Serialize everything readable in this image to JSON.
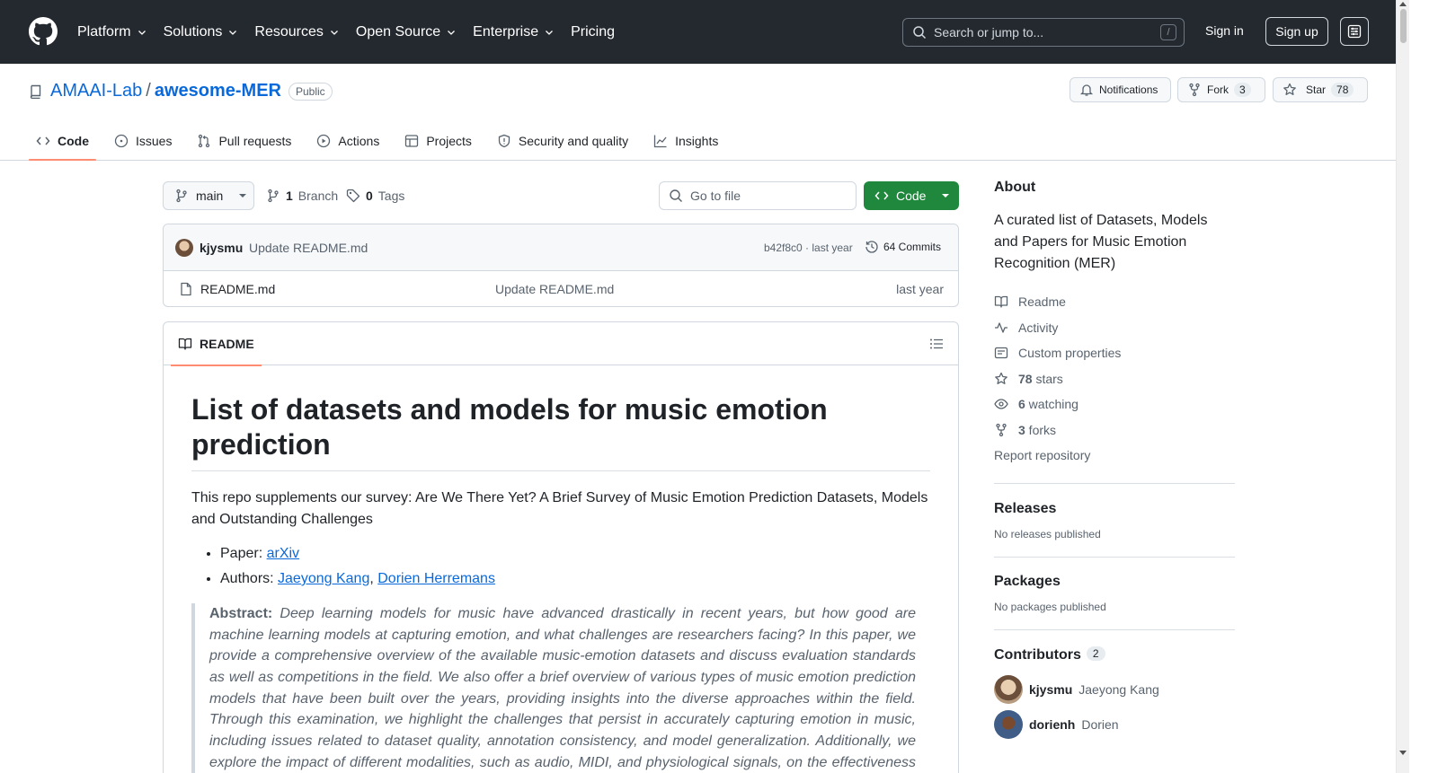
{
  "header": {
    "nav": [
      "Platform",
      "Solutions",
      "Resources",
      "Open Source",
      "Enterprise",
      "Pricing"
    ],
    "search_placeholder": "Search or jump to...",
    "search_shortcut": "/",
    "sign_in": "Sign in",
    "sign_up": "Sign up"
  },
  "repo": {
    "owner": "AMAAI-Lab",
    "separator": "/",
    "name": "awesome-MER",
    "visibility": "Public",
    "notifications_label": "Notifications",
    "fork_label": "Fork",
    "fork_count": "3",
    "star_label": "Star",
    "star_count": "78"
  },
  "tabs": [
    {
      "label": "Code",
      "icon": "code-icon",
      "active": true
    },
    {
      "label": "Issues",
      "icon": "issue-icon"
    },
    {
      "label": "Pull requests",
      "icon": "pull-request-icon"
    },
    {
      "label": "Actions",
      "icon": "play-icon"
    },
    {
      "label": "Projects",
      "icon": "table-icon"
    },
    {
      "label": "Security and quality",
      "icon": "shield-icon"
    },
    {
      "label": "Insights",
      "icon": "graph-icon"
    }
  ],
  "toolbar": {
    "branch": "main",
    "branch_count": "1",
    "branch_label": "Branch",
    "tag_count": "0",
    "tag_label": "Tags",
    "goto_placeholder": "Go to file",
    "code_button": "Code"
  },
  "commit": {
    "user": "kjysmu",
    "message": "Update README.md",
    "hash_time": "b42f8c0 · last year",
    "commits_label": "64 Commits"
  },
  "files": [
    {
      "name": "README.md",
      "message": "Update README.md",
      "time": "last year"
    }
  ],
  "readme": {
    "tab_label": "README",
    "title": "List of datasets and models for music emotion prediction",
    "lead": "This repo supplements our survey: Are We There Yet? A Brief Survey of Music Emotion Prediction Datasets, Models and Outstanding Challenges",
    "paper_label": "Paper: ",
    "paper_link": "arXiv",
    "authors_label": "Authors: ",
    "author1": "Jaeyong Kang",
    "author_sep": ", ",
    "author2": "Dorien Herremans",
    "abstract_label": "Abstract:",
    "abstract": " Deep learning models for music have advanced drastically in recent years, but how good are machine learning models at capturing emotion, and what challenges are researchers facing? In this paper, we provide a comprehensive overview of the available music-emotion datasets and discuss evaluation standards as well as competitions in the field. We also offer a brief overview of various types of music emotion prediction models that have been built over the years, providing insights into the diverse approaches within the field. Through this examination, we highlight the challenges that persist in accurately capturing emotion in music, including issues related to dataset quality, annotation consistency, and model generalization. Additionally, we explore the impact of different modalities, such as audio, MIDI, and physiological signals, on the effectiveness of emotion prediction models."
  },
  "about": {
    "title": "About",
    "description": "A curated list of Datasets, Models and Papers for Music Emotion Recognition (MER)",
    "readme": "Readme",
    "activity": "Activity",
    "custom_properties": "Custom properties",
    "stars_count": "78",
    "stars_label": " stars",
    "watching_count": "6",
    "watching_label": " watching",
    "forks_count": "3",
    "forks_label": " forks",
    "report": "Report repository"
  },
  "releases": {
    "title": "Releases",
    "empty": "No releases published"
  },
  "packages": {
    "title": "Packages",
    "empty": "No packages published"
  },
  "contributors": {
    "title": "Contributors",
    "count": "2",
    "list": [
      {
        "login": "kjysmu",
        "name": "Jaeyong Kang"
      },
      {
        "login": "dorienh",
        "name": "Dorien"
      }
    ]
  },
  "colors": {
    "accent": "#0969da",
    "primary_button": "#1f883d",
    "header_bg": "#24292f",
    "tab_underline": "#fd8c73"
  }
}
